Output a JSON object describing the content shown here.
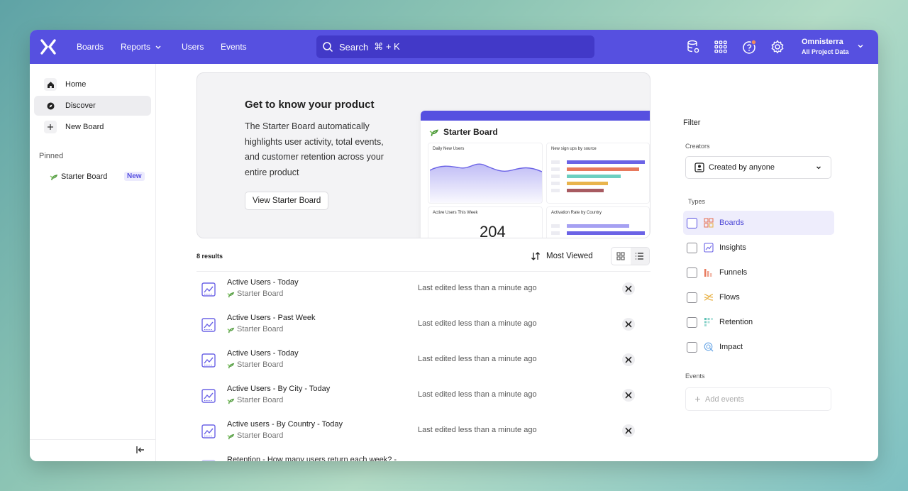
{
  "topbar": {
    "nav": [
      {
        "label": "Boards"
      },
      {
        "label": "Reports"
      },
      {
        "label": "Users"
      },
      {
        "label": "Events"
      }
    ],
    "search_label": "Search",
    "search_shortcut": "⌘ + K",
    "org_name": "Omnisterra",
    "org_sub": "All Project Data"
  },
  "sidebar": {
    "items": [
      {
        "label": "Home",
        "icon": "home-icon"
      },
      {
        "label": "Discover",
        "icon": "compass-icon"
      },
      {
        "label": "New Board",
        "icon": "plus-icon"
      }
    ],
    "pinned_heading": "Pinned",
    "pinned_item": "Starter Board",
    "new_badge": "New"
  },
  "hero": {
    "title": "Get to know your product",
    "description": "The Starter Board automatically highlights user activity, total events, and customer retention across your entire product",
    "button": "View Starter Board",
    "preview": {
      "title": "Starter Board",
      "cards": [
        {
          "title": "Daily New Users"
        },
        {
          "title": "New sign ups by source"
        },
        {
          "title": "Active Users This Week",
          "value": "204"
        },
        {
          "title": "Activation Rate by Country"
        }
      ]
    }
  },
  "results": {
    "count": "8 results",
    "sort": "Most Viewed",
    "rows": [
      {
        "title": "Active Users - Today",
        "board": "Starter Board",
        "edited": "Last edited less than a minute ago"
      },
      {
        "title": "Active Users - Past Week",
        "board": "Starter Board",
        "edited": "Last edited less than a minute ago"
      },
      {
        "title": "Active Users - Today",
        "board": "Starter Board",
        "edited": "Last edited less than a minute ago"
      },
      {
        "title": "Active Users - By City - Today",
        "board": "Starter Board",
        "edited": "Last edited less than a minute ago"
      },
      {
        "title": "Active users - By Country - Today",
        "board": "Starter Board",
        "edited": "Last edited less than a minute ago"
      },
      {
        "title": "Retention - How many users return each week? -",
        "board": "",
        "edited": ""
      }
    ]
  },
  "filter": {
    "heading": "Filter",
    "creators_label": "Creators",
    "creators_value": "Created by anyone",
    "types_label": "Types",
    "types": [
      {
        "label": "Boards",
        "icon": "boards-icon",
        "color": "#e8795d"
      },
      {
        "label": "Insights",
        "icon": "insights-icon",
        "color": "#6b63e6"
      },
      {
        "label": "Funnels",
        "icon": "funnels-icon",
        "color": "#e8795d"
      },
      {
        "label": "Flows",
        "icon": "flows-icon",
        "color": "#e9b44c"
      },
      {
        "label": "Retention",
        "icon": "retention-icon",
        "color": "#5fc2b6"
      },
      {
        "label": "Impact",
        "icon": "impact-icon",
        "color": "#6ba7e6"
      }
    ],
    "events_label": "Events",
    "add_events": "Add events"
  },
  "colors": {
    "brand": "#5650e0",
    "search_bg": "#4239c8"
  }
}
